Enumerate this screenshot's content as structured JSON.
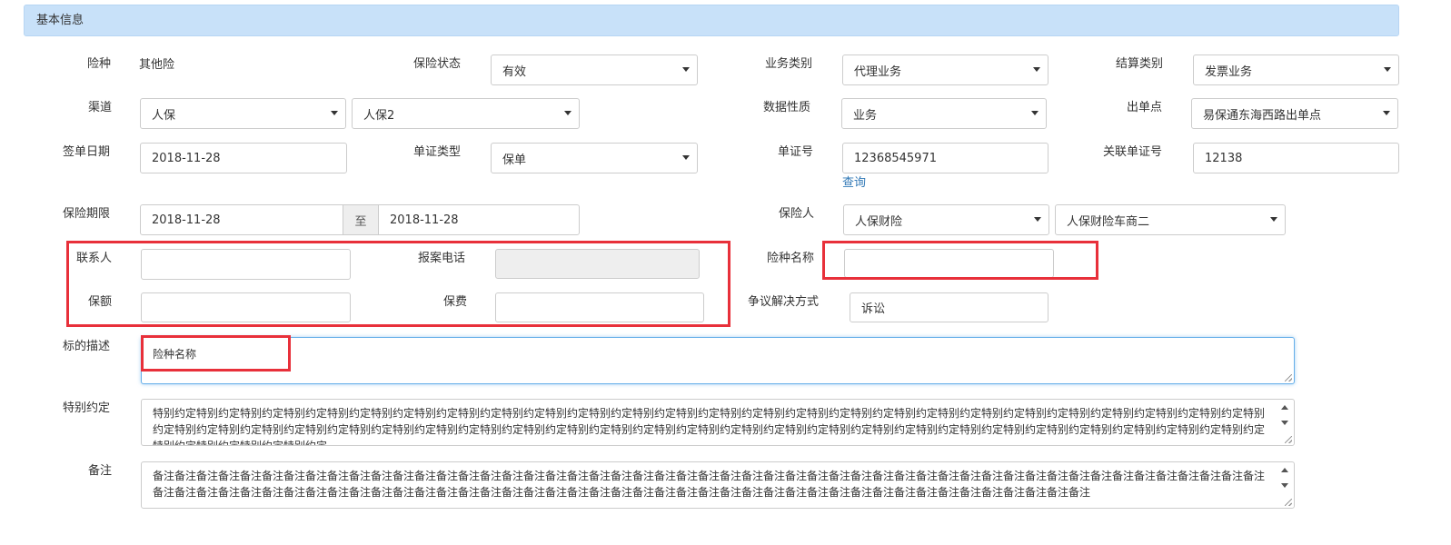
{
  "section": {
    "title": "基本信息"
  },
  "fields": {
    "insurance_type": {
      "label": "险种",
      "value": "其他险"
    },
    "insurance_status": {
      "label": "保险状态",
      "value": "有效"
    },
    "business_category": {
      "label": "业务类别",
      "value": "代理业务"
    },
    "settlement_category": {
      "label": "结算类别",
      "value": "发票业务"
    },
    "channel": {
      "label": "渠道",
      "value1": "人保",
      "value2": "人保2"
    },
    "data_nature": {
      "label": "数据性质",
      "value": "业务"
    },
    "issuing_point": {
      "label": "出单点",
      "value": "易保通东海西路出单点"
    },
    "sign_date": {
      "label": "签单日期",
      "value": "2018-11-28"
    },
    "document_type": {
      "label": "单证类型",
      "value": "保单"
    },
    "document_no": {
      "label": "单证号",
      "value": "12368545971",
      "link": "查询"
    },
    "related_document_no": {
      "label": "关联单证号",
      "value": "12138"
    },
    "insurance_period": {
      "label": "保险期限",
      "start": "2018-11-28",
      "separator": "至",
      "end": "2018-11-28"
    },
    "insurer": {
      "label": "保险人",
      "value1": "人保财险",
      "value2": "人保财险车商二"
    },
    "contact": {
      "label": "联系人",
      "value": ""
    },
    "report_phone": {
      "label": "报案电话",
      "value": ""
    },
    "insurance_name": {
      "label": "险种名称",
      "value": ""
    },
    "insured_amount": {
      "label": "保额",
      "value": ""
    },
    "premium": {
      "label": "保费",
      "value": ""
    },
    "dispute_resolution": {
      "label": "争议解决方式",
      "value": "诉讼"
    },
    "subject_description": {
      "label": "标的描述",
      "value": "险种名称"
    },
    "special_agreement": {
      "label": "特别约定",
      "value": "特别约定特别约定特别约定特别约定特别约定特别约定特别约定特别约定特别约定特别约定特别约定特别约定特别约定特别约定特别约定特别约定特别约定特别约定特别约定特别约定特别约定特别约定特别约定特别约定特别约定特别约定特别约定特别约定特别约定特别约定特别约定特别约定特别约定特别约定特别约定特别约定特别约定特别约定特别约定特别约定特别约定特别约定特别约定特别约定特别约定特别约定特别约定特别约定特别约定特别约定特别约定特别约定特别约定特别约定特别约定"
    },
    "remarks": {
      "label": "备注",
      "value": "备注备注备注备注备注备注备注备注备注备注备注备注备注备注备注备注备注备注备注备注备注备注备注备注备注备注备注备注备注备注备注备注备注备注备注备注备注备注备注备注备注备注备注备注备注备注备注备注备注备注备注备注备注备注备注备注备注备注备注备注备注备注备注备注备注备注备注备注备注备注备注备注备注备注备注备注备注备注备注备注备注备注备注备注备注备注备注备注备注备注备注备注备注备注"
    }
  },
  "colors": {
    "header_bg": "#c8e1f9",
    "highlight_box": "#e8303a",
    "link": "#337ab7",
    "disabled_bg": "#eeeeee"
  },
  "icons": {
    "select_caret": "caret-down-icon",
    "scroll_up": "scroll-up-arrow-icon",
    "scroll_down": "scroll-down-arrow-icon",
    "resize": "resize-grip-icon"
  }
}
